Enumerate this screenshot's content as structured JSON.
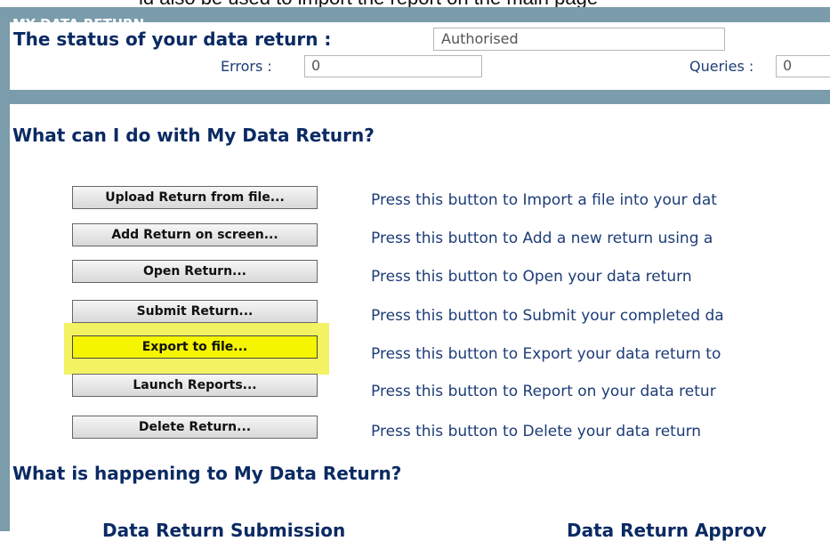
{
  "top_fragment": "ld also be used to import the report on the main page",
  "panel": {
    "tag": "MY DATA RETURN",
    "status_label": "The status of your data return :",
    "status_value": "Authorised",
    "errors_label": "Errors :",
    "errors_value": "0",
    "queries_label": "Queries :",
    "queries_value": "0"
  },
  "actions": {
    "heading": "What can I do with My Data Return?",
    "items": [
      {
        "button": "Upload Return from file...",
        "description": "Press this button to Import a file into your dat"
      },
      {
        "button": "Add Return on screen...",
        "description": "Press this button to Add a new return using a"
      },
      {
        "button": "Open Return...",
        "description": "Press this button to Open your data return"
      },
      {
        "button": "Submit Return...",
        "description": "Press this button to Submit your completed da"
      },
      {
        "button": "Export to file...",
        "description": "Press this button to Export your data return to"
      },
      {
        "button": "Launch Reports...",
        "description": "Press this button to Report on your data retur"
      },
      {
        "button": "Delete Return...",
        "description": "Press this button to Delete your data return"
      }
    ]
  },
  "progress": {
    "heading": "What is happening to My Data Return?",
    "left_title": "Data Return Submission",
    "right_title": "Data Return Approv"
  },
  "colors": {
    "frame": "#7a9cab",
    "heading_text": "#0a2a63",
    "highlight": "#f2f262"
  }
}
